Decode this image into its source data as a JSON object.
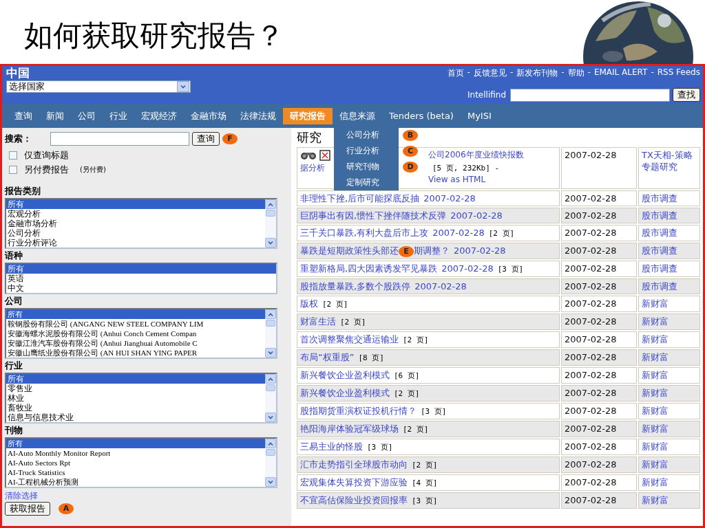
{
  "slide": {
    "title": "如何获取研究报告？"
  },
  "header": {
    "region": "中国",
    "country_select": "选择国家",
    "separator": "-",
    "links": [
      {
        "label": "首页"
      },
      {
        "label": "反馈意见"
      },
      {
        "label": "新发布刊物"
      },
      {
        "label": "帮助"
      },
      {
        "label": "EMAIL ALERT"
      },
      {
        "label": "RSS Feeds"
      }
    ],
    "search_label": "Intellifind",
    "search_button": "查找"
  },
  "nav": [
    {
      "label": "查询",
      "selected": false
    },
    {
      "label": "新闻",
      "selected": false
    },
    {
      "label": "公司",
      "selected": false
    },
    {
      "label": "行业",
      "selected": false
    },
    {
      "label": "宏观经济",
      "selected": false
    },
    {
      "label": "金融市场",
      "selected": false
    },
    {
      "label": "法律法规",
      "selected": false
    },
    {
      "label": "研究报告",
      "selected": true
    },
    {
      "label": "信息来源",
      "selected": false
    },
    {
      "label": "Tenders (beta)",
      "selected": false
    },
    {
      "label": "MyISI",
      "selected": false
    }
  ],
  "dropdown": [
    {
      "label": "公司分析",
      "badge": "B"
    },
    {
      "label": "行业分析",
      "badge": "C"
    },
    {
      "label": "研究刊物",
      "badge": "D"
    },
    {
      "label": "定制研究"
    }
  ],
  "sidebar": {
    "search_label": "搜索：",
    "search_button": "查询",
    "search_badge": "F",
    "checkboxes": [
      {
        "label": "仅查询标题",
        "checked": false
      },
      {
        "label": "另付费报告",
        "note": "(另付费)",
        "checked": false
      }
    ],
    "listboxes": [
      {
        "title": "报告类别",
        "scrollbar": true,
        "kind": "plain",
        "options": [
          {
            "label": "所有",
            "selected": true
          },
          {
            "label": "宏观分析",
            "selected": false
          },
          {
            "label": "金融市场分析",
            "selected": false
          },
          {
            "label": "公司分析",
            "selected": false
          },
          {
            "label": "行业分析评论",
            "selected": false
          }
        ]
      },
      {
        "title": "语种",
        "scrollbar": false,
        "kind": "plain",
        "options": [
          {
            "label": "所有",
            "selected": true
          },
          {
            "label": "英语",
            "selected": false
          },
          {
            "label": "中文",
            "selected": false
          }
        ]
      },
      {
        "title": "公司",
        "scrollbar": true,
        "kind": "serif",
        "options": [
          {
            "label": "所有",
            "selected": true
          },
          {
            "label": "鞍钢股份有限公司 (ANGANG NEW STEEL COMPANY LIM",
            "selected": false
          },
          {
            "label": "安徽海螺水泥股份有限公司 (Anhui Conch Cement Compan",
            "selected": false
          },
          {
            "label": "安徽江淮汽车股份有限公司 (Anhui Jianghuai Automobile C",
            "selected": false
          },
          {
            "label": "安徽山鹰纸业股份有限公司 (AN HUI SHAN YING PAPER",
            "selected": false
          }
        ]
      },
      {
        "title": "行业",
        "scrollbar": true,
        "kind": "plain",
        "options": [
          {
            "label": "所有",
            "selected": true
          },
          {
            "label": "零售业",
            "selected": false
          },
          {
            "label": "林业",
            "selected": false
          },
          {
            "label": "畜牧业",
            "selected": false
          },
          {
            "label": "信息与信息技术业",
            "selected": false
          }
        ]
      },
      {
        "title": "刊物",
        "scrollbar": true,
        "kind": "serif",
        "options": [
          {
            "label": "所有",
            "selected": true
          },
          {
            "label": "AI-Auto Monthly Monitor Report",
            "selected": false
          },
          {
            "label": "AI-Auto Sectors Rpt",
            "selected": false
          },
          {
            "label": "AI-Truck Statistics",
            "selected": false
          },
          {
            "label": "AI-工程机械分析预测",
            "selected": false
          }
        ]
      }
    ],
    "clear_link": "清除选择",
    "submit_button": "获取报告",
    "submit_badge": "A"
  },
  "results": {
    "heading": "研究",
    "featured": {
      "title": "公司2006年度业绩快报数",
      "title_end": "据分析",
      "pages": "[5 页, 232Kb] -",
      "link": "View as HTML",
      "date": "2007-02-28",
      "source": "TX天相-策略专题研究"
    },
    "rows": [
      {
        "parts": [
          {
            "kind": "title",
            "text": "非理性下挫,后市可能探底反抽"
          },
          {
            "kind": "date",
            "text": "2007-02-28"
          }
        ],
        "date": "2007-02-28",
        "source": "股市调查"
      },
      {
        "parts": [
          {
            "kind": "title",
            "text": "巨阴事出有因,惯性下挫伴随技术反弹"
          },
          {
            "kind": "date",
            "text": "2007-02-28"
          }
        ],
        "date": "2007-02-28",
        "source": "股市调查"
      },
      {
        "parts": [
          {
            "kind": "title",
            "text": "三千关口暴跌,有利大盘后市上攻"
          },
          {
            "kind": "date",
            "text": "2007-02-28"
          },
          {
            "kind": "pages",
            "text": "[2 页]"
          }
        ],
        "date": "2007-02-28",
        "source": "股市调查"
      },
      {
        "parts": [
          {
            "kind": "title",
            "text": "暴跌是短期政策性头部还"
          },
          {
            "kind": "badge",
            "text": "E"
          },
          {
            "kind": "title",
            "text": "期调整？"
          },
          {
            "kind": "date",
            "text": "2007-02-28"
          }
        ],
        "date": "2007-02-28",
        "source": "股市调查"
      },
      {
        "parts": [
          {
            "kind": "title",
            "text": "重塑新格局,四大因素诱发罕见暴跌"
          },
          {
            "kind": "date",
            "text": "2007-02-28"
          },
          {
            "kind": "pages",
            "text": "[3 页]"
          }
        ],
        "date": "2007-02-28",
        "source": "股市调查"
      },
      {
        "parts": [
          {
            "kind": "title",
            "text": "股指放量暴跌,多数个股跌停"
          },
          {
            "kind": "date",
            "text": "2007-02-28"
          }
        ],
        "date": "2007-02-28",
        "source": "股市调查"
      },
      {
        "parts": [
          {
            "kind": "title",
            "text": "版权"
          },
          {
            "kind": "pages",
            "text": "[2 页]"
          }
        ],
        "date": "2007-02-28",
        "source": "新财富"
      },
      {
        "parts": [
          {
            "kind": "title",
            "text": "财富生活"
          },
          {
            "kind": "pages",
            "text": "[2 页]"
          }
        ],
        "date": "2007-02-28",
        "source": "新财富"
      },
      {
        "parts": [
          {
            "kind": "title",
            "text": "首次调整聚焦交通运输业"
          },
          {
            "kind": "pages",
            "text": "[2 页]"
          }
        ],
        "date": "2007-02-28",
        "source": "新财富"
      },
      {
        "parts": [
          {
            "kind": "title",
            "text": "布局“权重股”"
          },
          {
            "kind": "pages",
            "text": "[8 页]"
          }
        ],
        "date": "2007-02-28",
        "source": "新财富"
      },
      {
        "parts": [
          {
            "kind": "title",
            "text": "新兴餐饮企业盈利模式"
          },
          {
            "kind": "pages",
            "text": "[6 页]"
          }
        ],
        "date": "2007-02-28",
        "source": "新财富"
      },
      {
        "parts": [
          {
            "kind": "title",
            "text": "新兴餐饮企业盈利模式"
          },
          {
            "kind": "pages",
            "text": "[2 页]"
          }
        ],
        "date": "2007-02-28",
        "source": "新财富"
      },
      {
        "parts": [
          {
            "kind": "title",
            "text": "股指期货重演权证投机行情？"
          },
          {
            "kind": "pages",
            "text": "[3 页]"
          }
        ],
        "date": "2007-02-28",
        "source": "新财富"
      },
      {
        "parts": [
          {
            "kind": "title",
            "text": "艳阳海岸体验冠军级球场"
          },
          {
            "kind": "pages",
            "text": "[2 页]"
          }
        ],
        "date": "2007-02-28",
        "source": "新财富"
      },
      {
        "parts": [
          {
            "kind": "title",
            "text": "三易主业的怪股"
          },
          {
            "kind": "pages",
            "text": "[3 页]"
          }
        ],
        "date": "2007-02-28",
        "source": "新财富"
      },
      {
        "parts": [
          {
            "kind": "title",
            "text": "汇市走势指引全球股市动向"
          },
          {
            "kind": "pages",
            "text": "[2 页]"
          }
        ],
        "date": "2007-02-28",
        "source": "新财富"
      },
      {
        "parts": [
          {
            "kind": "title",
            "text": "宏观集体失算投资下游应验"
          },
          {
            "kind": "pages",
            "text": "[4 页]"
          }
        ],
        "date": "2007-02-28",
        "source": "新财富"
      },
      {
        "parts": [
          {
            "kind": "title",
            "text": "不宜高估保险业投资回报率"
          },
          {
            "kind": "pages",
            "text": "[3 页]"
          }
        ],
        "date": "2007-02-28",
        "source": "新财富"
      }
    ]
  }
}
